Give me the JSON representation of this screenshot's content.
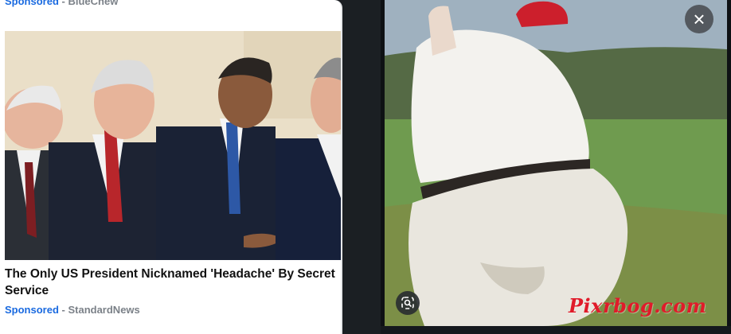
{
  "left_ad": {
    "top_label": {
      "sponsored": "Sponsored",
      "separator": " - ",
      "source": "BlueChew"
    },
    "image_icon": "photo-of-four-men-in-suits-laughing",
    "headline": "The Only US President Nicknamed 'Headache' By Secret Service",
    "bottom_label": {
      "sponsored": "Sponsored",
      "separator": " - ",
      "source": "StandardNews"
    }
  },
  "right_panel": {
    "image_icon": "photo-of-golfer-on-green-course",
    "watermark": "Pixrbog.com",
    "close_icon": "close-icon",
    "lens_icon": "image-search-icon"
  },
  "colors": {
    "sponsored_blue": "#1a6ae0",
    "source_gray": "#7b8188",
    "watermark_red": "#e01b2a",
    "background_dark": "#1a1d21"
  }
}
